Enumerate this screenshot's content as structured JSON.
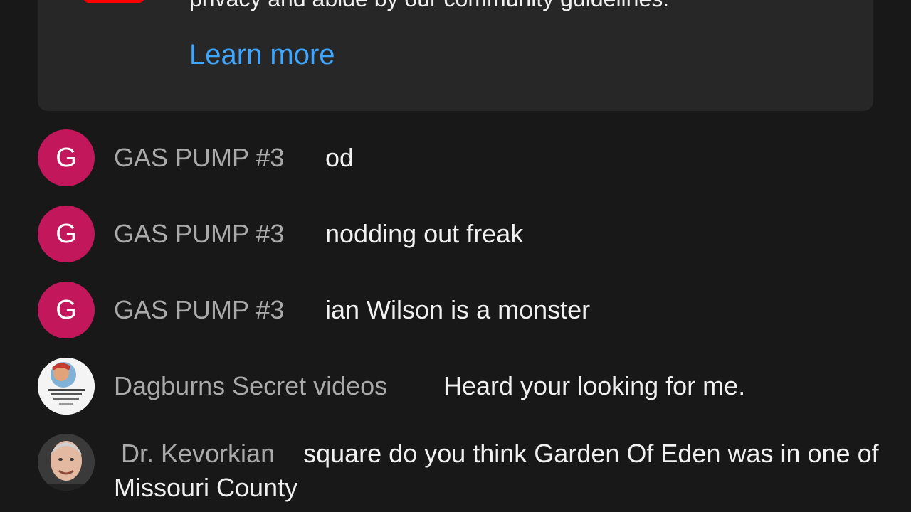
{
  "notice": {
    "text": "privacy and abide by our community guidelines.",
    "link": "Learn more",
    "logo_color": "#ff0000",
    "link_color": "#3ea6ff"
  },
  "messages": [
    {
      "avatar_letter": "G",
      "author": "GAS PUMP #3",
      "text": "od",
      "avatar_color": "#c2185b"
    },
    {
      "avatar_letter": "G",
      "author": "GAS PUMP #3",
      "text": "nodding out freak",
      "avatar_color": "#c2185b"
    },
    {
      "avatar_letter": "G",
      "author": "GAS PUMP #3",
      "text": "ian Wilson is a monster",
      "avatar_color": "#c2185b"
    },
    {
      "avatar_icon": "channel-thumbnail-avatar",
      "author": "Dagburns Secret videos",
      "text": "Heard your looking for me."
    },
    {
      "avatar_icon": "portrait-avatar",
      "author": "Dr. Kevorkian",
      "text": "square do you think Garden Of Eden was in one of Missouri County"
    }
  ]
}
